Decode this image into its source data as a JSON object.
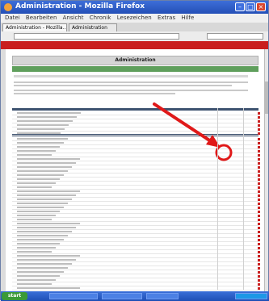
{
  "window": {
    "title": "Administration - Mozilla Firefox"
  },
  "menu": {
    "items": [
      "Datei",
      "Bearbeiten",
      "Ansicht",
      "Chronik",
      "Lesezeichen",
      "Extras",
      "Hilfe"
    ]
  },
  "tabs": [
    {
      "label": "Administration - Mozilla..."
    },
    {
      "label": "Administration"
    }
  ],
  "page": {
    "header_title": "Administration"
  },
  "chart_colors": {
    "accent_red": "#c91e1e",
    "green_bar": "#5f9f5c",
    "grid_header": "#3e5370"
  },
  "taskbar": {
    "start_label": "start"
  }
}
